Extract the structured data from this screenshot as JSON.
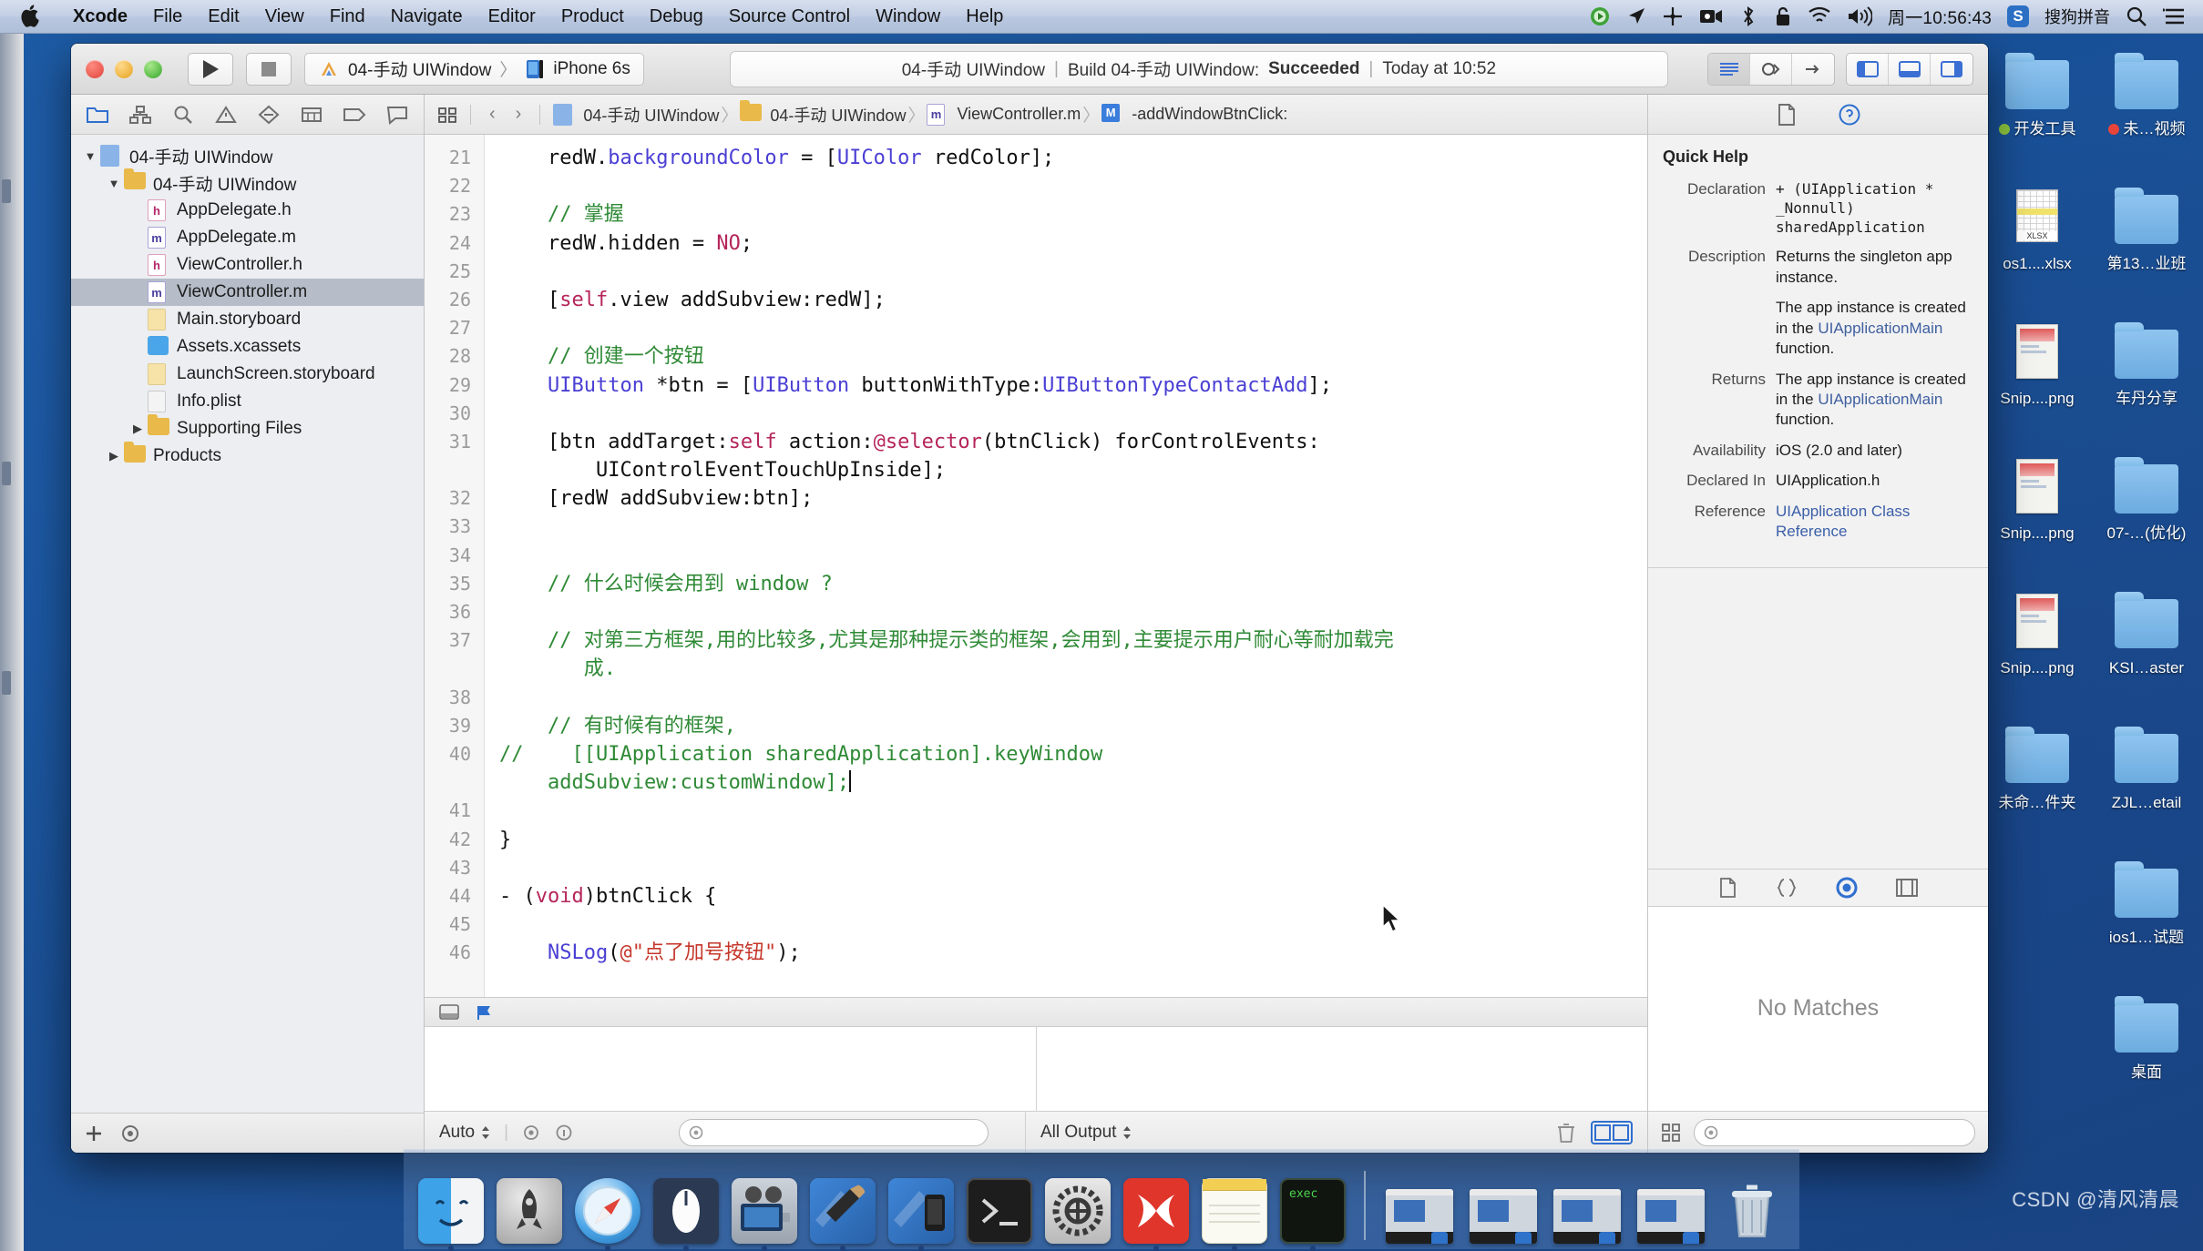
{
  "menubar": {
    "apple_label": "Apple menu",
    "items": [
      {
        "label": "Xcode",
        "bold": true
      },
      {
        "label": "File",
        "bold": false
      },
      {
        "label": "Edit",
        "bold": false
      },
      {
        "label": "View",
        "bold": false
      },
      {
        "label": "Find",
        "bold": false
      },
      {
        "label": "Navigate",
        "bold": false
      },
      {
        "label": "Editor",
        "bold": false
      },
      {
        "label": "Product",
        "bold": false
      },
      {
        "label": "Debug",
        "bold": false
      },
      {
        "label": "Source Control",
        "bold": false
      },
      {
        "label": "Window",
        "bold": false
      },
      {
        "label": "Help",
        "bold": false
      }
    ],
    "status_icons": [
      "record-green-icon",
      "location-arrow-icon",
      "airplay-icon",
      "screen-record-icon",
      "bluetooth-icon",
      "lock-icon",
      "wifi-icon",
      "volume-icon"
    ],
    "clock": "周一10:56:43",
    "input_method_badge": "S",
    "input_method": "搜狗拼音",
    "search_icon": "spotlight-search-icon",
    "notifications_icon": "notification-center-icon"
  },
  "xcode": {
    "toolbar": {
      "run_icon": "run-play-icon",
      "stop_icon": "stop-square-icon",
      "scheme_icon": "scheme-xcode-icon",
      "scheme": "04-手动 UIWindow",
      "scheme_sep": "〉",
      "destination_icon": "simulator-icon",
      "destination": "iPhone 6s",
      "activity": {
        "project": "04-手动 UIWindow",
        "sep": "|",
        "build_prefix": "Build 04-手动 UIWindow:",
        "build_status": "Succeeded",
        "time": "Today at 10:52"
      },
      "editor_segment": [
        "standard-editor-icon",
        "assistant-editor-icon",
        "version-editor-icon"
      ],
      "view_segment": [
        "hide-navigator-icon",
        "hide-debug-icon",
        "hide-utilities-icon"
      ]
    },
    "navigator": {
      "tabs": [
        "project-navigator-icon",
        "symbol-navigator-icon",
        "find-navigator-icon",
        "issue-navigator-icon",
        "test-navigator-icon",
        "debug-navigator-icon",
        "breakpoint-navigator-icon",
        "report-navigator-icon"
      ],
      "tree": [
        {
          "label": "04-手动 UIWindow",
          "depth": 0,
          "icon": "project-icon",
          "twisty": "down",
          "selected": false
        },
        {
          "label": "04-手动 UIWindow",
          "depth": 1,
          "icon": "folder-icon",
          "twisty": "down",
          "selected": false
        },
        {
          "label": "AppDelegate.h",
          "depth": 2,
          "icon": "header-file-icon",
          "twisty": "",
          "selected": false
        },
        {
          "label": "AppDelegate.m",
          "depth": 2,
          "icon": "impl-file-icon",
          "twisty": "",
          "selected": false
        },
        {
          "label": "ViewController.h",
          "depth": 2,
          "icon": "header-file-icon",
          "twisty": "",
          "selected": false
        },
        {
          "label": "ViewController.m",
          "depth": 2,
          "icon": "impl-file-icon",
          "twisty": "",
          "selected": true
        },
        {
          "label": "Main.storyboard",
          "depth": 2,
          "icon": "storyboard-icon",
          "twisty": "",
          "selected": false
        },
        {
          "label": "Assets.xcassets",
          "depth": 2,
          "icon": "assets-icon",
          "twisty": "",
          "selected": false
        },
        {
          "label": "LaunchScreen.storyboard",
          "depth": 2,
          "icon": "storyboard-icon",
          "twisty": "",
          "selected": false
        },
        {
          "label": "Info.plist",
          "depth": 2,
          "icon": "plist-icon",
          "twisty": "",
          "selected": false
        },
        {
          "label": "Supporting Files",
          "depth": 2,
          "icon": "folder-icon",
          "twisty": "right",
          "selected": false
        },
        {
          "label": "Products",
          "depth": 1,
          "icon": "folder-icon",
          "twisty": "right",
          "selected": false
        }
      ],
      "footer": [
        "add-button",
        "filter-icon"
      ]
    },
    "jumpbar": {
      "related_icon": "related-files-icon",
      "back_icon": "chevron-left-icon",
      "forward_icon": "chevron-right-icon",
      "crumbs": [
        {
          "label": "04-手动 UIWindow",
          "icon": "project-icon"
        },
        {
          "label": "04-手动 UIWindow",
          "icon": "folder-icon"
        },
        {
          "label": "ViewController.m",
          "icon": "impl-file-icon"
        },
        {
          "label": "-addWindowBtnClick:",
          "icon": "method-icon"
        }
      ],
      "separator": "〉"
    },
    "code": {
      "first_line_number": 21,
      "lines": [
        {
          "n": 21,
          "tokens": [
            {
              "t": "    redW.",
              "c": "plain"
            },
            {
              "t": "backgroundColor",
              "c": "type"
            },
            {
              "t": " = [",
              "c": "plain"
            },
            {
              "t": "UIColor",
              "c": "type"
            },
            {
              "t": " redColor];",
              "c": "plain"
            }
          ]
        },
        {
          "n": 22,
          "tokens": []
        },
        {
          "n": 23,
          "tokens": [
            {
              "t": "    // 掌握",
              "c": "cmt"
            }
          ]
        },
        {
          "n": 24,
          "tokens": [
            {
              "t": "    redW.hidden = ",
              "c": "plain"
            },
            {
              "t": "NO",
              "c": "self"
            },
            {
              "t": ";",
              "c": "plain"
            }
          ]
        },
        {
          "n": 25,
          "tokens": []
        },
        {
          "n": 26,
          "tokens": [
            {
              "t": "    [",
              "c": "plain"
            },
            {
              "t": "self",
              "c": "self"
            },
            {
              "t": ".view addSubview:redW];",
              "c": "plain"
            }
          ]
        },
        {
          "n": 27,
          "tokens": []
        },
        {
          "n": 28,
          "tokens": [
            {
              "t": "    // 创建一个按钮",
              "c": "cmt"
            }
          ]
        },
        {
          "n": 29,
          "tokens": [
            {
              "t": "    ",
              "c": "plain"
            },
            {
              "t": "UIButton",
              "c": "type"
            },
            {
              "t": " *btn = [",
              "c": "plain"
            },
            {
              "t": "UIButton",
              "c": "type"
            },
            {
              "t": " buttonWithType:",
              "c": "plain"
            },
            {
              "t": "UIButtonTypeContactAdd",
              "c": "type"
            },
            {
              "t": "];",
              "c": "plain"
            }
          ]
        },
        {
          "n": 30,
          "tokens": []
        },
        {
          "n": 31,
          "tokens": [
            {
              "t": "    [btn addTarget:",
              "c": "plain"
            },
            {
              "t": "self",
              "c": "self"
            },
            {
              "t": " action:",
              "c": "plain"
            },
            {
              "t": "@selector",
              "c": "self"
            },
            {
              "t": "(btnClick) forControlEvents:",
              "c": "plain"
            }
          ]
        },
        {
          "n": "",
          "tokens": [
            {
              "t": "        UIControlEventTouchUpInside];",
              "c": "plain"
            }
          ]
        },
        {
          "n": 32,
          "tokens": [
            {
              "t": "    [redW addSubview:btn];",
              "c": "plain"
            }
          ]
        },
        {
          "n": 33,
          "tokens": []
        },
        {
          "n": 34,
          "tokens": []
        },
        {
          "n": 35,
          "tokens": [
            {
              "t": "    // 什么时候会用到 window ?",
              "c": "cmt"
            }
          ]
        },
        {
          "n": 36,
          "tokens": []
        },
        {
          "n": 37,
          "tokens": [
            {
              "t": "    // 对第三方框架,用的比较多,尤其是那种提示类的框架,会用到,主要提示用户耐心等耐加载完",
              "c": "cmt"
            }
          ]
        },
        {
          "n": "",
          "tokens": [
            {
              "t": "       成.",
              "c": "cmt"
            }
          ]
        },
        {
          "n": 38,
          "tokens": []
        },
        {
          "n": 39,
          "tokens": [
            {
              "t": "    // 有时候有的框架,",
              "c": "cmt"
            }
          ]
        },
        {
          "n": 40,
          "tokens": [
            {
              "t": "//    [[UIApplication sharedApplication].keyWindow",
              "c": "cmt"
            }
          ]
        },
        {
          "n": "",
          "tokens": [
            {
              "t": "    addSubview:customWindow];",
              "c": "cmt"
            },
            {
              "t": "CARET",
              "c": "caret"
            }
          ]
        },
        {
          "n": 41,
          "tokens": []
        },
        {
          "n": 42,
          "tokens": [
            {
              "t": "}",
              "c": "plain"
            }
          ]
        },
        {
          "n": 43,
          "tokens": []
        },
        {
          "n": 44,
          "tokens": [
            {
              "t": "- (",
              "c": "plain"
            },
            {
              "t": "void",
              "c": "self"
            },
            {
              "t": ")btnClick {",
              "c": "plain"
            }
          ]
        },
        {
          "n": 45,
          "tokens": []
        },
        {
          "n": 46,
          "tokens": [
            {
              "t": "    ",
              "c": "plain"
            },
            {
              "t": "NSLog",
              "c": "type"
            },
            {
              "t": "(",
              "c": "plain"
            },
            {
              "t": "@\"点了加号按钮\"",
              "c": "str"
            },
            {
              "t": ");",
              "c": "plain"
            }
          ]
        }
      ]
    },
    "debug": {
      "header_icons": [
        "hide-debug-bar-icon",
        "continue-flag-icon"
      ],
      "variables_filter_placeholder": "",
      "scope_menu": "Auto",
      "scope_icons": [
        "eye-icon",
        "info-icon"
      ],
      "output_menu": "All Output",
      "trash_icon": "trash-icon",
      "split_icons": [
        "show-variables-icon",
        "show-console-icon"
      ]
    },
    "inspector": {
      "tabs": [
        "file-inspector-icon",
        "quick-help-inspector-icon"
      ],
      "quick_help": {
        "title": "Quick Help",
        "rows": [
          {
            "key": "Declaration",
            "value": "+ (UIApplication *\n_Nonnull)\nsharedApplication",
            "mono": true
          },
          {
            "key": "Description",
            "value": "Returns the singleton app instance.",
            "mono": false
          },
          {
            "key": "",
            "value": "The app instance is created in the UIApplicationMain function.",
            "mono": false,
            "blue_terms": [
              "UIApplicationMain"
            ]
          },
          {
            "key": "Returns",
            "value": "The app instance is created in the UIApplicationMain function.",
            "mono": false,
            "blue_terms": [
              "UIApplicationMain"
            ]
          },
          {
            "key": "Availability",
            "value": "iOS (2.0 and later)",
            "mono": false
          },
          {
            "key": "Declared In",
            "value": "UIApplication.h",
            "mono": false
          },
          {
            "key": "Reference",
            "value": "UIApplication Class Reference",
            "mono": false,
            "link": true
          }
        ]
      },
      "library_tabs": [
        "file-template-library-icon",
        "code-snippet-library-icon",
        "object-library-icon",
        "media-library-icon"
      ],
      "library_empty": "No Matches",
      "library_filter_placeholder": "",
      "library_footer_icons": [
        "grid-view-icon"
      ]
    }
  },
  "desktop": {
    "icons": [
      {
        "label": "开发工具",
        "type": "folder",
        "tag": "#8ec63f"
      },
      {
        "label": "未…视频",
        "type": "folder",
        "tag": "#e8443a"
      },
      {
        "label": "os1....xlsx",
        "type": "xlsx",
        "tag": ""
      },
      {
        "label": "第13…业班",
        "type": "folder",
        "tag": ""
      },
      {
        "label": "Snip....png",
        "type": "image",
        "tag": ""
      },
      {
        "label": "车丹分享",
        "type": "folder",
        "tag": ""
      },
      {
        "label": "Snip....png",
        "type": "image",
        "tag": ""
      },
      {
        "label": "07-…(优化)",
        "type": "folder",
        "tag": ""
      },
      {
        "label": "Snip....png",
        "type": "image2",
        "tag": ""
      },
      {
        "label": "KSI…aster",
        "type": "folder",
        "tag": ""
      },
      {
        "label": "未命…件夹",
        "type": "folder",
        "tag": ""
      },
      {
        "label": "ZJL…etail",
        "type": "folder",
        "tag": ""
      },
      {
        "label": "",
        "type": "none",
        "tag": ""
      },
      {
        "label": "ios1…试题",
        "type": "folder",
        "tag": ""
      },
      {
        "label": "",
        "type": "none",
        "tag": ""
      },
      {
        "label": "桌面",
        "type": "folder",
        "tag": ""
      }
    ],
    "dock": [
      {
        "name": "finder-icon",
        "running": true
      },
      {
        "name": "launchpad-icon",
        "running": false
      },
      {
        "name": "safari-icon",
        "running": true
      },
      {
        "name": "mouse-app-icon",
        "running": true
      },
      {
        "name": "quicktime-icon",
        "running": true
      },
      {
        "name": "xcode-icon",
        "running": true
      },
      {
        "name": "simulator-icon",
        "running": true
      },
      {
        "name": "terminal-icon",
        "running": false
      },
      {
        "name": "system-preferences-icon",
        "running": false
      },
      {
        "name": "xmind-icon",
        "running": true
      },
      {
        "name": "notes-icon",
        "running": true
      },
      {
        "name": "exec-icon",
        "running": true
      }
    ],
    "dock_minimized_count": 4,
    "dock_trash_icon": "trash-icon"
  },
  "watermark": "CSDN @清风清晨"
}
